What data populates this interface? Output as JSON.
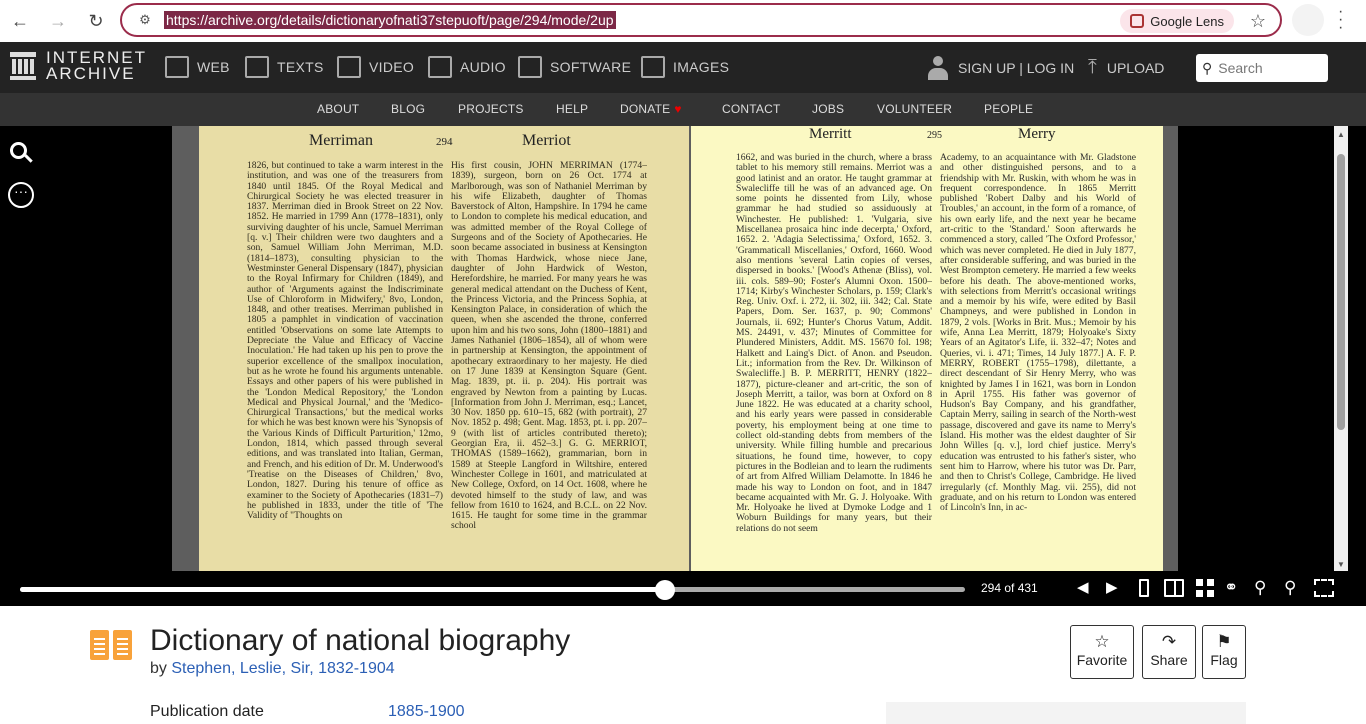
{
  "browser": {
    "url": "https://archive.org/details/dictionaryofnati37stepuoft/page/294/mode/2up",
    "lens_label": "Google Lens"
  },
  "ia_nav": {
    "logo_top": "INTERNET",
    "logo_bottom": "ARCHIVE",
    "items": [
      "WEB",
      "TEXTS",
      "VIDEO",
      "AUDIO",
      "SOFTWARE",
      "IMAGES"
    ],
    "signin": "SIGN UP | LOG IN",
    "upload": "UPLOAD",
    "search_placeholder": "Search"
  },
  "sub_nav": [
    "ABOUT",
    "BLOG",
    "PROJECTS",
    "HELP",
    "DONATE",
    "CONTACT",
    "JOBS",
    "VOLUNTEER",
    "PEOPLE"
  ],
  "reader": {
    "left_page": {
      "head_left": "Merriman",
      "number": "294",
      "head_right": "Merriot",
      "col1": "1826, but continued to take a warm interest in the institution, and was one of the treasurers from 1840 until 1845. Of the Royal Medical and Chirurgical Society he was elected treasurer in 1837. Merriman died in Brook Street on 22 Nov. 1852. He married in 1799 Ann (1778–1831), only surviving daughter of his uncle, Samuel Merriman [q. v.] Their children were two daughters and a son, Samuel William John Merriman, M.D. (1814–1873), consulting physician to the Westminster General Dispensary (1847), physician to the Royal Infirmary for Children (1849), and author of 'Arguments against the Indiscriminate Use of Chloroform in Midwifery,' 8vo, London, 1848, and other treatises. Merriman published in 1805 a pamphlet in vindication of vaccination entitled 'Observations on some late Attempts to Depreciate the Value and Efficacy of Vaccine Inoculation.' He had taken up his pen to prove the superior excellence of the smallpox inoculation, but as he wrote he found his arguments untenable. Essays and other papers of his were published in the 'London Medical Repository,' the 'London Medical and Physical Journal,' and the 'Medico-Chirurgical Transactions,' but the medical works for which he was best known were his 'Synopsis of the Various Kinds of Difficult Parturition,' 12mo, London, 1814, which passed through several editions, and was translated into Italian, German, and French, and his edition of Dr. M. Underwood's 'Treatise on the Diseases of Children,' 8vo, London, 1827. During his tenure of office as examiner to the Society of Apothecaries (1831–7) he published in 1833, under the title of 'The Validity of \"Thoughts on",
      "col2": "His first cousin, JOHN MERRIMAN (1774–1839), surgeon, born on 26 Oct. 1774 at Marlborough, was son of Nathaniel Merriman by his wife Elizabeth, daughter of Thomas Baverstock of Alton, Hampshire. In 1794 he came to London to complete his medical education, and was admitted member of the Royal College of Surgeons and of the Society of Apothecaries. He soon became associated in business at Kensington with Thomas Hardwick, whose niece Jane, daughter of John Hardwick of Weston, Herefordshire, he married. For many years he was general medical attendant on the Duchess of Kent, the Princess Victoria, and the Princess Sophia, at Kensington Palace, in consideration of which the queen, when she ascended the throne, conferred upon him and his two sons, John (1800–1881) and James Nathaniel (1806–1854), all of whom were in partnership at Kensington, the appointment of apothecary extraordinary to her majesty. He died on 17 June 1839 at Kensington Square (Gent. Mag. 1839, pt. ii. p. 204). His portrait was engraved by Newton from a painting by Lucas. [Information from John J. Merriman, esq.; Lancet, 30 Nov. 1850 pp. 610–15, 682 (with portrait), 27 Nov. 1852 p. 498; Gent. Mag. 1853, pt. i. pp. 207–9 (with list of articles contributed thereto); Georgian Era, ii. 452–3.] G. G. MERRIOT, THOMAS (1589–1662), grammarian, born in 1589 at Steeple Langford in Wiltshire, entered Winchester College in 1601, and matriculated at New College, Oxford, on 14 Oct. 1608, where he devoted himself to the study of law, and was fellow from 1610 to 1624, and B.C.L. on 22 Nov. 1615. He taught for some time in the grammar school"
    },
    "right_page": {
      "head_left": "Merritt",
      "number": "295",
      "head_right": "Merry",
      "col1": "1662, and was buried in the church, where a brass tablet to his memory still remains. Merriot was a good latinist and an orator. He taught grammar at Swalecliffe till he was of an advanced age. On some points he dissented from Lily, whose grammar he had studied so assiduously at Winchester. He published: 1. 'Vulgaria, sive Miscellanea prosaica hinc inde decerpta,' Oxford, 1652. 2. 'Adagia Selectissima,' Oxford, 1652. 3. 'Grammaticall Miscellanies,' Oxford, 1660. Wood also mentions 'several Latin copies of verses, dispersed in books.' [Wood's Athenæ (Bliss), vol. iii. cols. 589–90; Foster's Alumni Oxon. 1500–1714; Kirby's Winchester Scholars, p. 159; Clark's Reg. Univ. Oxf. i. 272, ii. 302, iii. 342; Cal. State Papers, Dom. Ser. 1637, p. 90; Commons' Journals, ii. 692; Hunter's Chorus Vatum, Addit. MS. 24491, v. 437; Minutes of Committee for Plundered Ministers, Addit. MS. 15670 fol. 198; Halkett and Laing's Dict. of Anon. and Pseudon. Lit.; information from the Rev. Dr. Wilkinson of Swalecliffe.] B. P. MERRITT, HENRY (1822–1877), picture-cleaner and art-critic, the son of Joseph Merritt, a tailor, was born at Oxford on 8 June 1822. He was educated at a charity school, and his early years were passed in considerable poverty, his employment being at one time to collect old-standing debts from members of the university. While filling humble and precarious situations, he found time, however, to copy pictures in the Bodleian and to learn the rudiments of art from Alfred William Delamotte. In 1846 he made his way to London on foot, and in 1847 became acquainted with Mr. G. J. Holyoake. With Mr. Holyoake he lived at Dymoke Lodge and 1 Woburn Buildings for many years, but their relations do not seem",
      "col2": "Academy, to an acquaintance with Mr. Gladstone and other distinguished persons, and to a friendship with Mr. Ruskin, with whom he was in frequent correspondence. In 1865 Merritt published 'Robert Dalby and his World of Troubles,' an account, in the form of a romance, of his own early life, and the next year he became art-critic to the 'Standard.' Soon afterwards he commenced a story, called 'The Oxford Professor,' which was never completed. He died in July 1877, after considerable suffering, and was buried in the West Brompton cemetery. He married a few weeks before his death. The above-mentioned works, with selections from Merritt's occasional writings and a memoir by his wife, were edited by Basil Champneys, and were published in London in 1879, 2 vols. [Works in Brit. Mus.; Memoir by his wife, Anna Lea Merritt, 1879; Holyoake's Sixty Years of an Agitator's Life, ii. 332–47; Notes and Queries, vi. i. 471; Times, 14 July 1877.] A. F. P. MERRY, ROBERT (1755–1798), dilettante, a direct descendant of Sir Henry Merry, who was knighted by James I in 1621, was born in London in April 1755. His father was governor of Hudson's Bay Company, and his grandfather, Captain Merry, sailing in search of the North-west passage, discovered and gave its name to Merry's Island. His mother was the eldest daughter of Sir John Willes [q. v.], lord chief justice. Merry's education was entrusted to his father's sister, who sent him to Harrow, where his tutor was Dr. Parr, and then to Christ's College, Cambridge. He lived irregularly (cf. Monthly Mag. vii. 255), did not graduate, and on his return to London was entered of Lincoln's Inn, in ac-"
    },
    "page_count": "294 of 431",
    "progress_fraction": 0.6826
  },
  "item": {
    "title": "Dictionary of national biography",
    "by": "by",
    "author": "Stephen, Leslie, Sir, 1832-1904",
    "pub_label": "Publication date",
    "pub_value": "1885-1900",
    "actions": {
      "favorite": "Favorite",
      "share": "Share",
      "flag": "Flag"
    }
  },
  "icons": [
    "back-icon",
    "forward-icon",
    "reload-icon",
    "tune-icon",
    "lens-icon",
    "star-icon",
    "search-icon",
    "more-icon",
    "prev-page-icon",
    "next-page-icon",
    "single-page-icon",
    "two-page-icon",
    "gallery-icon",
    "read-aloud-icon",
    "zoom-out-icon",
    "zoom-in-icon",
    "fullscreen-icon",
    "book-icon",
    "favorite-icon",
    "share-icon",
    "flag-icon"
  ],
  "colors": {
    "ia_nav": "#232323",
    "sub_nav": "#333333",
    "link": "#2b5fb5",
    "book_icon": "#f8a23a",
    "url_border": "#9b2c4b"
  }
}
